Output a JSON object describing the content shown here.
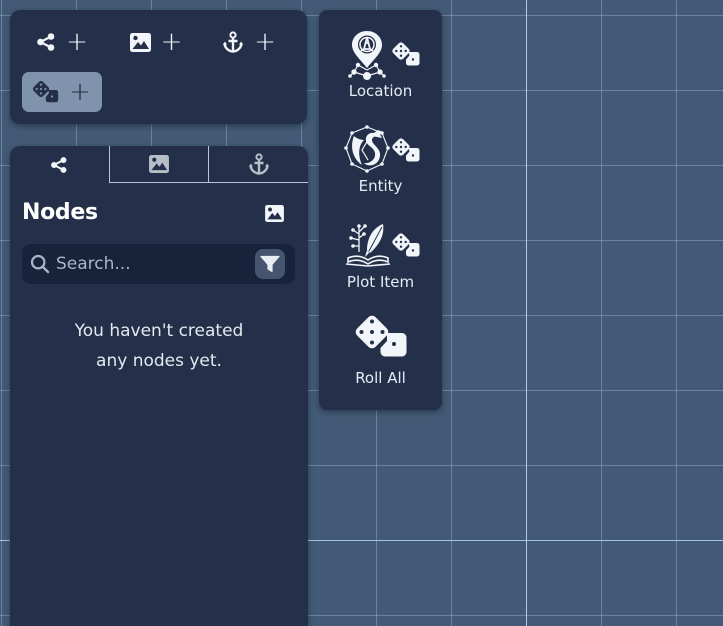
{
  "toolbar": {
    "buttons": [
      {
        "icon": "share-nodes-icon",
        "action_icon": "plus-icon",
        "label": "+",
        "active": false
      },
      {
        "icon": "image-icon",
        "action_icon": "plus-icon",
        "label": "+",
        "active": false
      },
      {
        "icon": "anchor-icon",
        "action_icon": "plus-icon",
        "label": "+",
        "active": false
      },
      {
        "icon": "dice-icon",
        "action_icon": "plus-icon",
        "label": "+",
        "active": true
      }
    ]
  },
  "sidepanel": {
    "tabs": [
      {
        "icon": "share-nodes-icon",
        "active": true
      },
      {
        "icon": "image-icon",
        "active": false
      },
      {
        "icon": "anchor-icon",
        "active": false
      }
    ],
    "title": "Nodes",
    "header_icon": "image-icon",
    "search": {
      "value": "",
      "placeholder": "Search..."
    },
    "filter_icon": "filter-icon",
    "empty_message_line1": "You haven't created",
    "empty_message_line2": "any nodes yet."
  },
  "palette": {
    "items": [
      {
        "label": "Location",
        "icon": "location-map-pin-icon",
        "badge_icon": "dice-icon"
      },
      {
        "label": "Entity",
        "icon": "dragon-icon",
        "badge_icon": "dice-icon"
      },
      {
        "label": "Plot Item",
        "icon": "quill-book-icon",
        "badge_icon": "dice-icon"
      },
      {
        "label": "Roll All",
        "icon": "dice-icon"
      }
    ]
  },
  "colors": {
    "canvas_bg": "#425a75",
    "panel_bg": "#243049",
    "active_button_bg": "#8093ad",
    "search_bg": "#18223a",
    "text": "#ffffff"
  }
}
